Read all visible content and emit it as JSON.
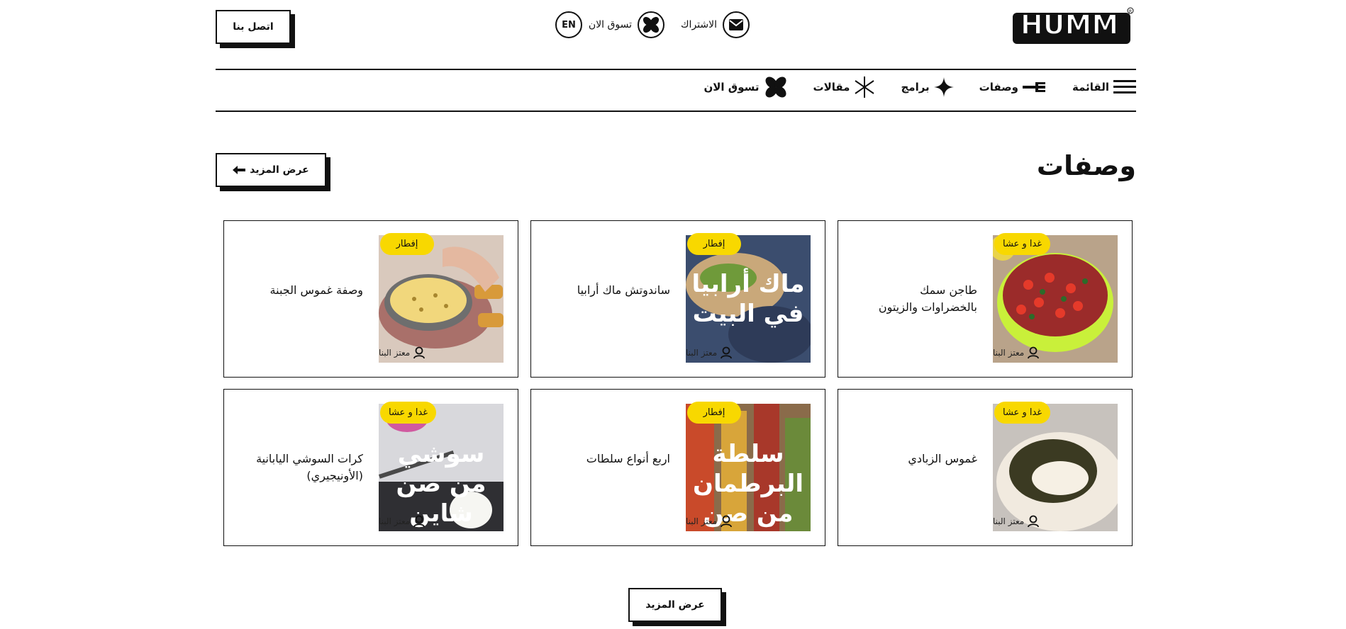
{
  "header": {
    "logo_text": "HUMM",
    "subscribe_label": "الاشتراك",
    "shop_label": "تسوق الان",
    "lang_label": "EN",
    "contact_label": "اتصل بنا"
  },
  "nav": {
    "items": [
      {
        "label": "القائمة",
        "icon": "menu-icon"
      },
      {
        "label": "وصفات",
        "icon": "utensil-icon"
      },
      {
        "label": "برامج",
        "icon": "sparkle-icon"
      },
      {
        "label": "مقالات",
        "icon": "asterisk-icon"
      },
      {
        "label": "تسوق الان",
        "icon": "propeller-icon"
      }
    ]
  },
  "section": {
    "title": "وصفات",
    "more_label": "عرض المزيد"
  },
  "cards": [
    {
      "title": "طاجن سمك بالخضراوات والزيتون",
      "badge": "غدا و عشا",
      "author": "معتز البنا",
      "image": "salad-bowl"
    },
    {
      "title": "ساندوتش ماك أرابيا",
      "badge": "إفطار",
      "author": "معتز البنا",
      "image": "mac-arabia",
      "image_text": "ماك أرابيا في البيت"
    },
    {
      "title": "وصفة غموس الجبنة",
      "badge": "إفطار",
      "author": "معتز البنا",
      "image": "cheese-dip"
    },
    {
      "title": "غموس الزبادي",
      "badge": "غدا و عشا",
      "author": "معتز البنا",
      "image": "yogurt-dip"
    },
    {
      "title": "اربع أنواع سلطات",
      "badge": "إفطار",
      "author": "معتز البنا",
      "image": "jar-salads",
      "image_text": "سلطة البرطمان من صن شاين"
    },
    {
      "title": "كرات السوشي اليابانية (الأونيجيري)",
      "badge": "غدا و عشا",
      "author": "معتز البنا",
      "image": "sushi",
      "image_text": "سوشي من صن شاين"
    }
  ],
  "footer": {
    "more_label": "عرض المزيد"
  },
  "colors": {
    "accent": "#f8d800",
    "ink": "#111111"
  }
}
